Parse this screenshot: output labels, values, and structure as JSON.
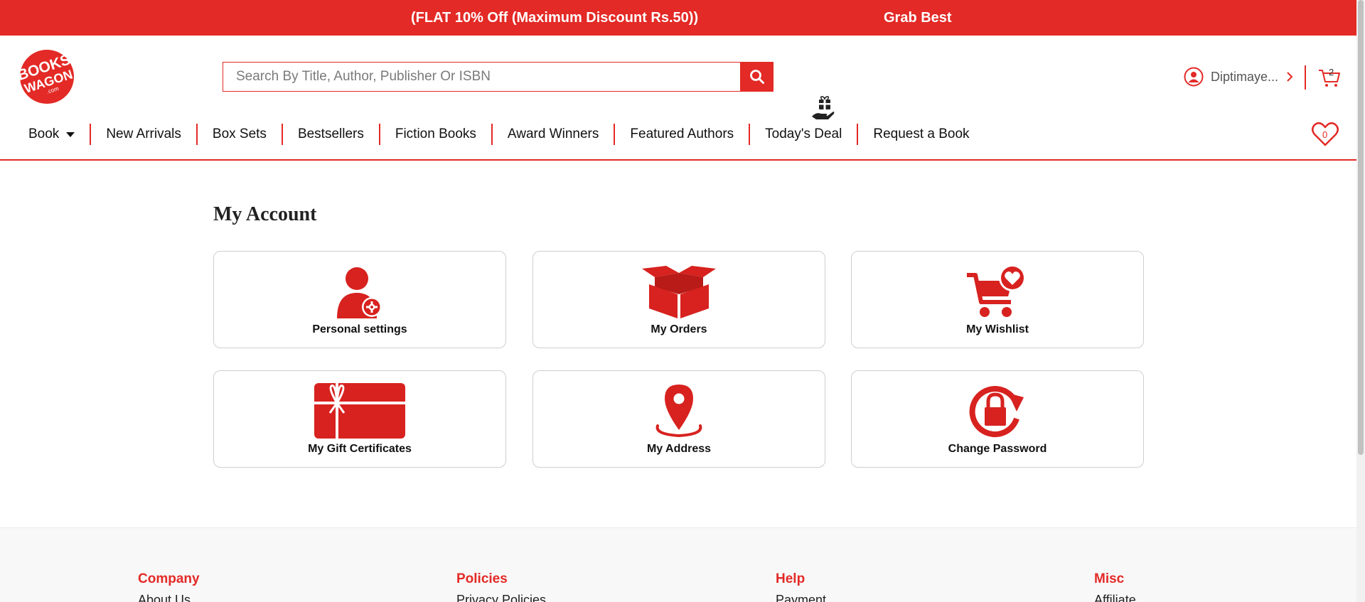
{
  "promo": {
    "text_left": "(FLAT 10% Off (Maximum Discount Rs.50))",
    "text_right": "Grab Best"
  },
  "header": {
    "logo_text": [
      "BOOKS",
      "WAGON",
      ".com"
    ],
    "search_placeholder": "Search By Title, Author, Publisher Or ISBN",
    "user_name": "Diptimaye...",
    "cart_count": "2",
    "wishlist_count": "0"
  },
  "nav": {
    "items": [
      "Book",
      "New Arrivals",
      "Box Sets",
      "Bestsellers",
      "Fiction Books",
      "Award Winners",
      "Featured Authors",
      "Today's Deal",
      "Request a Book"
    ]
  },
  "main": {
    "title": "My Account",
    "cards": [
      {
        "label": "Personal settings",
        "icon": "user-settings-icon"
      },
      {
        "label": "My Orders",
        "icon": "open-box-icon"
      },
      {
        "label": "My Wishlist",
        "icon": "cart-heart-icon"
      },
      {
        "label": "My Gift Certificates",
        "icon": "gift-card-icon"
      },
      {
        "label": "My Address",
        "icon": "map-pin-icon"
      },
      {
        "label": "Change Password",
        "icon": "lock-refresh-icon"
      }
    ]
  },
  "footer": {
    "columns": [
      {
        "heading": "Company",
        "link": "About Us"
      },
      {
        "heading": "Policies",
        "link": "Privacy Policies"
      },
      {
        "heading": "Help",
        "link": "Payment"
      },
      {
        "heading": "Misc",
        "link": "Affiliate"
      }
    ]
  },
  "colors": {
    "brand": "#e32a26",
    "text": "#111111",
    "border": "#cfcfcf"
  }
}
